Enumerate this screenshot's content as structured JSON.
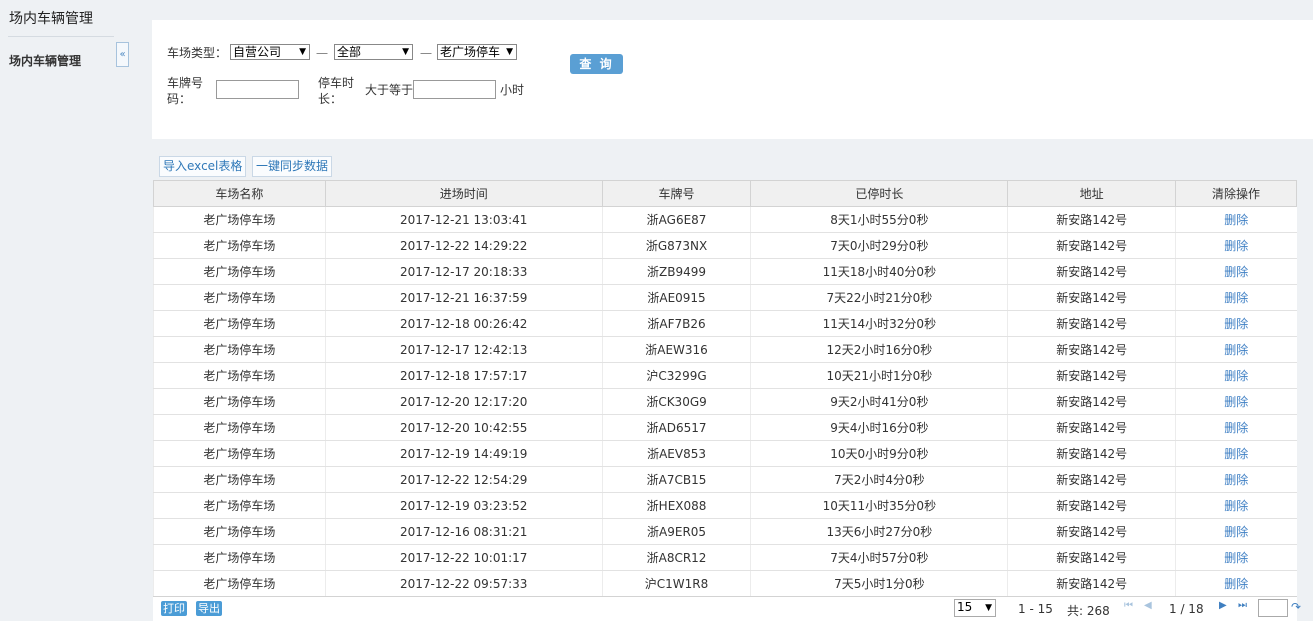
{
  "sidebar": {
    "title": "场内车辆管理",
    "nav_item": "场内车辆管理",
    "collapse": "«"
  },
  "filters": {
    "lot_type_label": "车场类型：",
    "lot_type_value": "自营公司",
    "region_value": "全部",
    "lot_value": "老广场停车",
    "dash": "一",
    "plate_label_1": "车牌号",
    "plate_label_2": "码：",
    "duration_label_1": "停车时",
    "duration_label_2": "长：",
    "greater_label": "大于等于",
    "unit_label": "小时",
    "query_button": "查 询"
  },
  "toolbar": {
    "import_button": "导入excel表格",
    "sync_button": "一键同步数据"
  },
  "table": {
    "columns": [
      "车场名称",
      "进场时间",
      "车牌号",
      "已停时长",
      "地址",
      "清除操作"
    ],
    "rows": [
      [
        "老广场停车场",
        "2017-12-21 13:03:41",
        "浙AG6E87",
        "8天1小时55分0秒",
        "新安路142号",
        "删除"
      ],
      [
        "老广场停车场",
        "2017-12-22 14:29:22",
        "浙G873NX",
        "7天0小时29分0秒",
        "新安路142号",
        "删除"
      ],
      [
        "老广场停车场",
        "2017-12-17 20:18:33",
        "浙ZB9499",
        "11天18小时40分0秒",
        "新安路142号",
        "删除"
      ],
      [
        "老广场停车场",
        "2017-12-21 16:37:59",
        "浙AE0915",
        "7天22小时21分0秒",
        "新安路142号",
        "删除"
      ],
      [
        "老广场停车场",
        "2017-12-18 00:26:42",
        "浙AF7B26",
        "11天14小时32分0秒",
        "新安路142号",
        "删除"
      ],
      [
        "老广场停车场",
        "2017-12-17 12:42:13",
        "浙AEW316",
        "12天2小时16分0秒",
        "新安路142号",
        "删除"
      ],
      [
        "老广场停车场",
        "2017-12-18 17:57:17",
        "沪C3299G",
        "10天21小时1分0秒",
        "新安路142号",
        "删除"
      ],
      [
        "老广场停车场",
        "2017-12-20 12:17:20",
        "浙CK30G9",
        "9天2小时41分0秒",
        "新安路142号",
        "删除"
      ],
      [
        "老广场停车场",
        "2017-12-20 10:42:55",
        "浙AD6517",
        "9天4小时16分0秒",
        "新安路142号",
        "删除"
      ],
      [
        "老广场停车场",
        "2017-12-19 14:49:19",
        "浙AEV853",
        "10天0小时9分0秒",
        "新安路142号",
        "删除"
      ],
      [
        "老广场停车场",
        "2017-12-22 12:54:29",
        "浙A7CB15",
        "7天2小时4分0秒",
        "新安路142号",
        "删除"
      ],
      [
        "老广场停车场",
        "2017-12-19 03:23:52",
        "浙HEX088",
        "10天11小时35分0秒",
        "新安路142号",
        "删除"
      ],
      [
        "老广场停车场",
        "2017-12-16 08:31:21",
        "浙A9ER05",
        "13天6小时27分0秒",
        "新安路142号",
        "删除"
      ],
      [
        "老广场停车场",
        "2017-12-22 10:01:17",
        "浙A8CR12",
        "7天4小时57分0秒",
        "新安路142号",
        "删除"
      ],
      [
        "老广场停车场",
        "2017-12-22 09:57:33",
        "沪C1W1R8",
        "7天5小时1分0秒",
        "新安路142号",
        "删除"
      ]
    ]
  },
  "pager": {
    "print_button": "打印",
    "export_button": "导出",
    "page_size": "15",
    "range": "1 - 15",
    "total": "共: 268",
    "page_status": "1 / 18",
    "first_icon": "⏮",
    "prev_icon": "◀",
    "next_icon": "▶",
    "last_icon": "⏭",
    "go_icon": "↷"
  }
}
